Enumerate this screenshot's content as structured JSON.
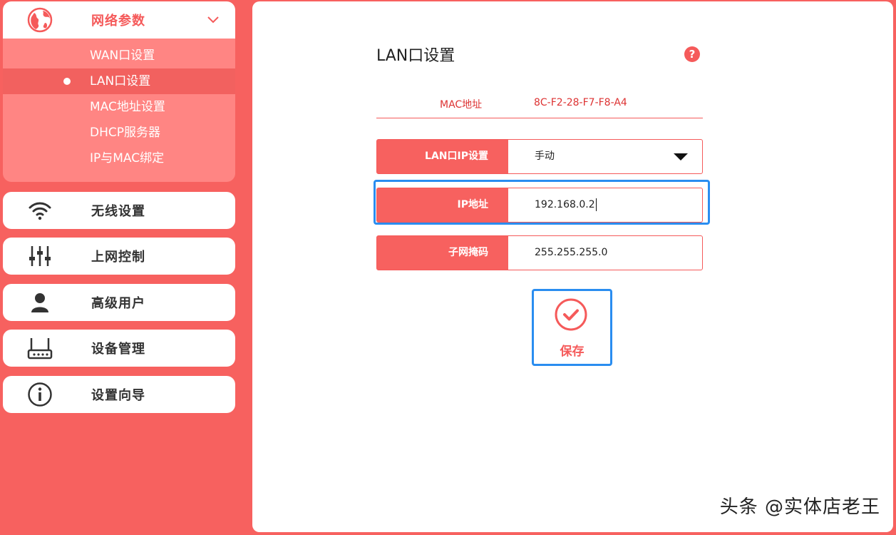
{
  "sidebar": {
    "network": {
      "label": "网络参数",
      "icon": "globe-icon",
      "subitems": [
        {
          "label": "WAN口设置"
        },
        {
          "label": "LAN口设置",
          "active": true
        },
        {
          "label": "MAC地址设置"
        },
        {
          "label": "DHCP服务器"
        },
        {
          "label": "IP与MAC绑定"
        }
      ]
    },
    "items": [
      {
        "label": "无线设置",
        "icon": "wifi-icon"
      },
      {
        "label": "上网控制",
        "icon": "sliders-icon"
      },
      {
        "label": "高级用户",
        "icon": "user-icon"
      },
      {
        "label": "设备管理",
        "icon": "router-icon"
      },
      {
        "label": "设置向导",
        "icon": "info-icon"
      }
    ]
  },
  "main": {
    "title": "LAN口设置",
    "help_icon": "?",
    "mac": {
      "label": "MAC地址",
      "value": "8C-F2-28-F7-F8-A4"
    },
    "lan_ip_mode": {
      "label": "LAN口IP设置",
      "value": "手动"
    },
    "ip_address": {
      "label": "IP地址",
      "value": "192.168.0.2"
    },
    "subnet_mask": {
      "label": "子网掩码",
      "value": "255.255.255.0"
    },
    "save_label": "保存"
  },
  "watermark": "头条 @实体店老王",
  "colors": {
    "accent": "#f7615f",
    "focus": "#2a8df0"
  }
}
